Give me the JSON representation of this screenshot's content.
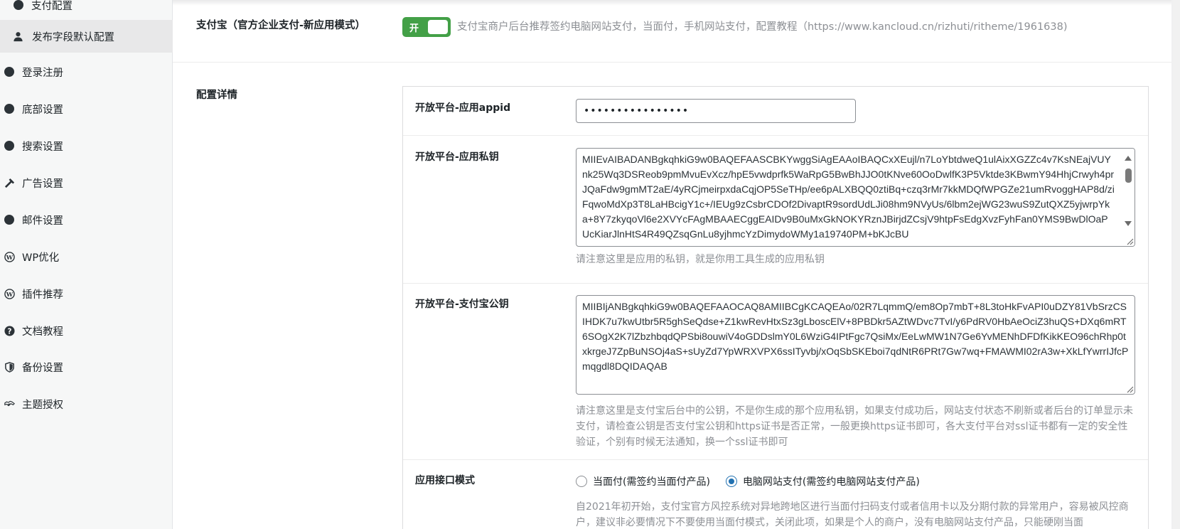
{
  "sidebar": {
    "items": [
      {
        "label": "支付配置",
        "icon": "dot-icon"
      },
      {
        "label": "发布字段默认配置",
        "icon": "user-icon"
      },
      {
        "label": "登录注册",
        "icon": "dot-icon"
      },
      {
        "label": "底部设置",
        "icon": "dot-icon"
      },
      {
        "label": "搜索设置",
        "icon": "dot-icon"
      },
      {
        "label": "广告设置",
        "icon": "hammer-icon"
      },
      {
        "label": "邮件设置",
        "icon": "dot-icon"
      },
      {
        "label": "WP优化",
        "icon": "wordpress-icon"
      },
      {
        "label": "插件推荐",
        "icon": "wordpress-icon"
      },
      {
        "label": "文档教程",
        "icon": "help-icon"
      },
      {
        "label": "备份设置",
        "icon": "shield-icon"
      },
      {
        "label": "主题授权",
        "icon": "handshake-icon"
      }
    ]
  },
  "alipay_row": {
    "label": "支付宝（官方企业支付-新应用模式）",
    "toggle_text": "开",
    "toggle_on": true,
    "help": "支付宝商户后台推荐签约电脑网站支付，当面付，手机网站支付，配置教程（https://www.kancloud.cn/rizhuti/ritheme/1961638)"
  },
  "config_row": {
    "label": "配置详情"
  },
  "fields": {
    "appid": {
      "label": "开放平台-应用appid",
      "value": "••••••••••••••••"
    },
    "private_key": {
      "label": "开放平台-应用私钥",
      "value": "MIIEvAIBADANBgkqhkiG9w0BAQEFAASCBKYwggSiAgEAAoIBAQCxXEujl/n7LoYbtdweQ1ulAixXGZZc4v7KsNEajVUYnk25Wq3DSReob9pmMvuEvXcz/hpE5vwdprfk5WaRpG5BwBhJJO0tKNve60OoDwlfK3P5Vktde3KBwmY94HhjCrwyh4prJQaFdw9gmMT2aE/4yRCjmeirpxdaCqjOP5SeTHp/ee6pALXBQQ0ztiBq+czq3rMr7kkMDQfWPGZe21umRvoggHAP8d/ziFqwoMdXp3T8LaHBcigY1c+/IEUg9zCsbrCDOf2DivaptR9sordUdLJi08hm9NVyUs/6lbm2ejWG23wuS9ZutQXZ5yjwrpYka+8Y7zkyqoVl6e2XVYcFAgMBAAECggEAIDv9B0uMxGkNOKYRznJBirjdZCsjV9htpFsEdgXvzFyhFan0YMS9BwDlOaPUcKiarJlnHtS4R49QZsqGnLu8yjhmcYzDimydoWMy1a19740PM+bKJcBU",
      "help": "请注意这里是应用的私钥，就是你用工具生成的应用私钥"
    },
    "public_key": {
      "label": "开放平台-支付宝公钥",
      "value": "MIIBIjANBgkqhkiG9w0BAQEFAAOCAQ8AMIIBCgKCAQEAo/02R7LqmmQ/em8Op7mbT+8L3toHkFvAPI0uDZY81VbSrzCSIHDK7u7kwUtbr5R5ghSeQdse+Z1kwRevHtxSz3gLboscElV+8PBDkr5AZtWDvc7TvI/y6PdRV0HbAeOciZ3huQS+DXq6mRT6SOgX2K7lZbzhbqdQPSbi8ouwiV4oGDDslmY0L6WziG4IPtFgc7QsiMx/EeLwMW1N7Ge6YvMENhDFDfKikKEO96chRhp0txkrgeJ7ZpBuNSOj4aS+sUyZd7YpWRXVPX6ssITyvbj/xOqSbSKEboi7qdNtR6PRt7Gw7wq+FMAWMI02rA3w+XkLfYwrrIJfcPmqgdl8DQIDAQAB",
      "help": "请注意这里是支付宝后台中的公钥，不是你生成的那个应用私钥，如果支付成功后，网站支付状态不刷新或者后台的订单显示未支付，请检查公钥是否支付宝公钥和https证书是否正常，一般更换https证书即可，各大支付平台对ssl证书都有一定的安全性验证，个别有时候无法通知，换一个ssl证书即可"
    },
    "api_mode": {
      "label": "应用接口模式",
      "options": [
        {
          "label": "当面付(需签约当面付产品)",
          "checked": false
        },
        {
          "label": "电脑网站支付(需签约电脑网站支付产品)",
          "checked": true
        }
      ],
      "help": "自2021年初开始，支付宝官方风控系统对异地跨地区进行当面付扫码支付或者信用卡以及分期付款的异常用户，容易被风控商户，建议非必要情况下不要使用当面付模式，关闭此项，如果是个人的商户，没有电脑网站支付产品，只能硬刚当面"
    }
  },
  "colors": {
    "toggle_on": "#43a047",
    "radio_checked": "#2271b1",
    "help_text": "#8c8f94"
  }
}
